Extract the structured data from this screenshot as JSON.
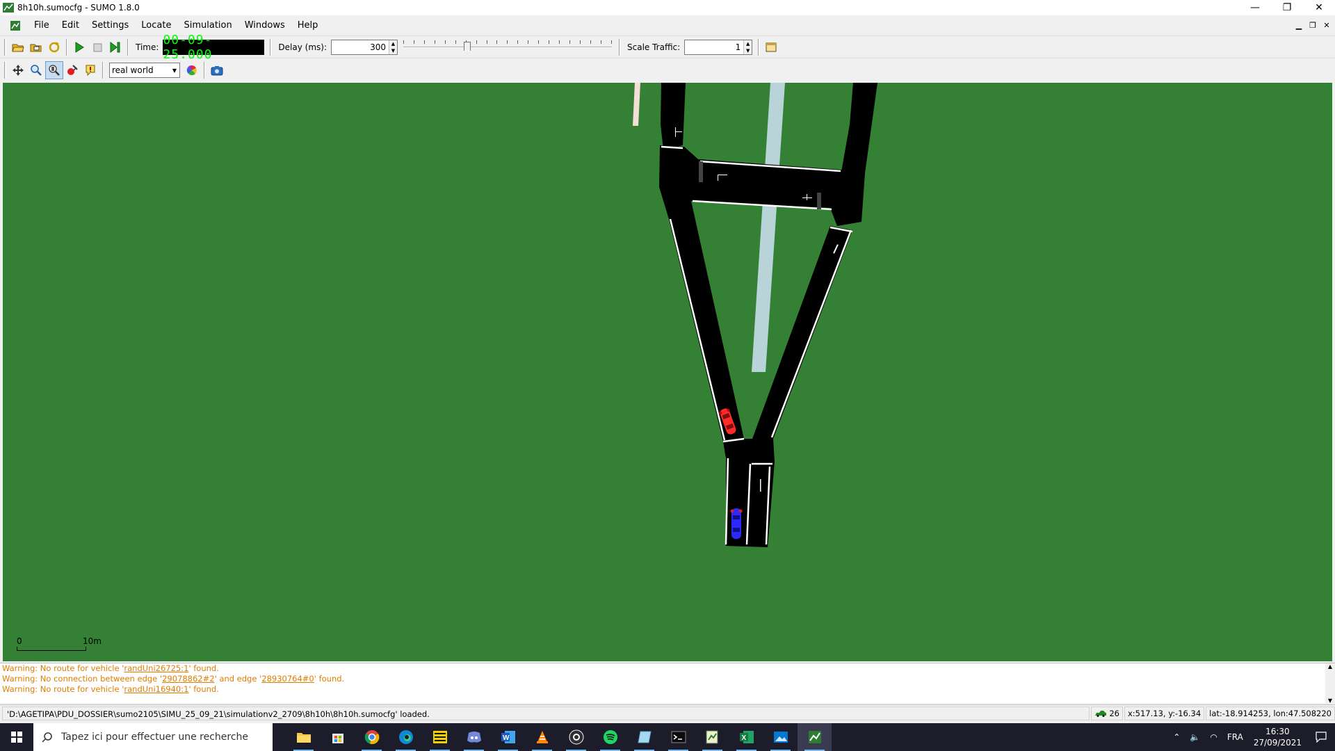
{
  "window": {
    "title": "8h10h.sumocfg - SUMO 1.8.0",
    "minimize": "—",
    "restore": "❐",
    "close": "✕"
  },
  "menu": {
    "items": [
      "File",
      "Edit",
      "Settings",
      "Locate",
      "Simulation",
      "Windows",
      "Help"
    ]
  },
  "toolbar": {
    "time_label": "Time:",
    "time_value": "00-09-25.000",
    "delay_label": "Delay (ms):",
    "delay_value": "300",
    "delay_slider_fraction": 0.3,
    "scale_label": "Scale Traffic:",
    "scale_value": "1"
  },
  "view_toolbar": {
    "scheme": "real world"
  },
  "canvas": {
    "scale_start": "0",
    "scale_end": "10m",
    "background_color": "#348034",
    "vehicles": [
      {
        "color": "#ff2a2a",
        "label": "red vehicle"
      },
      {
        "color": "#2a2aff",
        "label": "blue vehicle"
      }
    ]
  },
  "messages": [
    {
      "pre": "Warning: No route for vehicle '",
      "link": "randUni26725:1",
      "post": "' found.",
      "link2": "",
      "post2": ""
    },
    {
      "pre": "Warning: No connection between edge '",
      "link": "29078862#2",
      "post": "' and edge '",
      "link2": "28930764#0",
      "post2": "' found."
    },
    {
      "pre": "Warning: No route for vehicle '",
      "link": "randUni16940:1",
      "post": "' found.",
      "link2": "",
      "post2": ""
    }
  ],
  "status": {
    "message": "'D:\\AGETIPA\\PDU_DOSSIER\\sumo2105\\SIMU_25_09_21\\simulationv2_2709\\8h10h\\8h10h.sumocfg' loaded.",
    "vehicle_count": "26",
    "xy": "x:517.13, y:-16.34",
    "latlon": "lat:-18.914253, lon:47.508220"
  },
  "taskbar": {
    "search_placeholder": "Tapez ici pour effectuer une recherche",
    "language": "FRA",
    "time": "16:30",
    "date": "27/09/2021"
  }
}
